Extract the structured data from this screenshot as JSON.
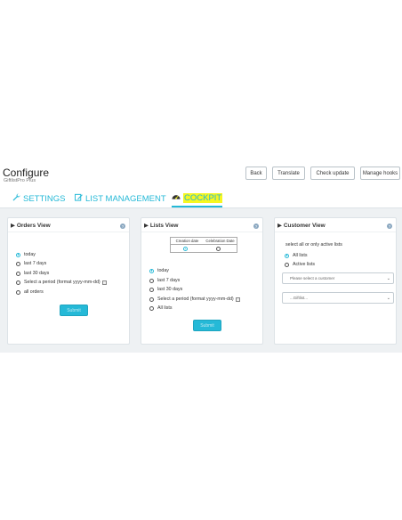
{
  "header": {
    "title": "Configure",
    "subtitle": "GiftlistPro Plus",
    "buttons": {
      "back": "Back",
      "translate": "Translate",
      "check_update": "Check update",
      "manage_hooks": "Manage hooks"
    }
  },
  "tabs": [
    {
      "label": "SETTINGS",
      "icon": "wrench-icon"
    },
    {
      "label": "LIST MANAGEMENT",
      "icon": "edit-icon"
    },
    {
      "label": "COCKPIT",
      "icon": "dashboard-icon",
      "active": true
    }
  ],
  "panels": {
    "orders": {
      "title": "Orders View",
      "options": [
        "today",
        "last 7 days",
        "last 30 days",
        "Select a period (format yyyy-mm-dd)",
        "all orders"
      ],
      "selected": "today",
      "submit_label": "Submit"
    },
    "lists": {
      "title": "Lists View",
      "date_columns": [
        "Creation date",
        "Celebration Date"
      ],
      "date_selected": "Creation date",
      "options": [
        "today",
        "last 7 days",
        "last 30 days",
        "Select a period (format yyyy-mm-dd)",
        "All lists"
      ],
      "selected": "today",
      "submit_label": "Submit"
    },
    "customer": {
      "title": "Customer View",
      "info": "select all or only active lists",
      "options": [
        "All lists",
        "Active lists"
      ],
      "selected": "All lists",
      "customer_select": "Please select a customer",
      "giftlist_select": "...Giftlist..."
    }
  },
  "colors": {
    "accent": "#25b9d7",
    "highlight": "#f7f71f",
    "background": "#eef1f3"
  }
}
